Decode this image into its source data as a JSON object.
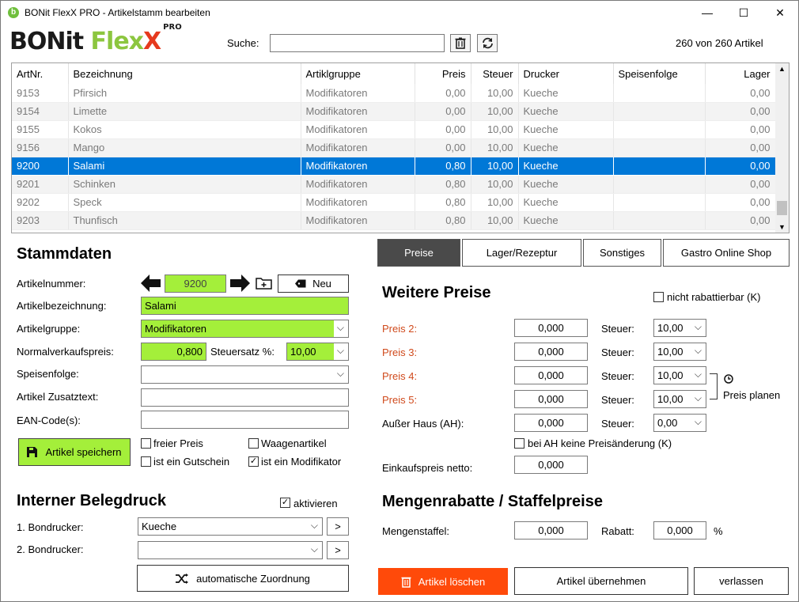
{
  "window": {
    "title": "BONit FlexX PRO - Artikelstamm bearbeiten",
    "minimize": "—",
    "maximize": "☐",
    "close": "✕"
  },
  "logo": {
    "part1": "BONit ",
    "part2": "Fle",
    "part3": "x",
    "part4": "X",
    "pro": "PRO"
  },
  "search": {
    "label": "Suche:",
    "value": ""
  },
  "count": "260 von 260 Artikel",
  "table": {
    "headers": [
      "ArtNr.",
      "Bezeichnung",
      "Artiklgruppe",
      "Preis",
      "Steuer",
      "Drucker",
      "Speisenfolge",
      "Lager"
    ],
    "rows": [
      [
        "9153",
        "Pfirsich",
        "Modifikatoren",
        "0,00",
        "10,00",
        "Kueche",
        "",
        "0,00"
      ],
      [
        "9154",
        "Limette",
        "Modifikatoren",
        "0,00",
        "10,00",
        "Kueche",
        "",
        "0,00"
      ],
      [
        "9155",
        "Kokos",
        "Modifikatoren",
        "0,00",
        "10,00",
        "Kueche",
        "",
        "0,00"
      ],
      [
        "9156",
        "Mango",
        "Modifikatoren",
        "0,00",
        "10,00",
        "Kueche",
        "",
        "0,00"
      ],
      [
        "9200",
        "Salami",
        "Modifikatoren",
        "0,80",
        "10,00",
        "Kueche",
        "",
        "0,00"
      ],
      [
        "9201",
        "Schinken",
        "Modifikatoren",
        "0,80",
        "10,00",
        "Kueche",
        "",
        "0,00"
      ],
      [
        "9202",
        "Speck",
        "Modifikatoren",
        "0,80",
        "10,00",
        "Kueche",
        "",
        "0,00"
      ],
      [
        "9203",
        "Thunfisch",
        "Modifikatoren",
        "0,80",
        "10,00",
        "Kueche",
        "",
        "0,00"
      ]
    ],
    "selected_index": 4
  },
  "stammdaten": {
    "title": "Stammdaten",
    "artikelnummer_label": "Artikelnummer:",
    "artikelnummer": "9200",
    "neu_label": "Neu",
    "bezeichnung_label": "Artikelbezeichnung:",
    "bezeichnung": "Salami",
    "gruppe_label": "Artikelgruppe:",
    "gruppe": "Modifikatoren",
    "vk_label": "Normalverkaufspreis:",
    "vk": "0,800",
    "steuersatz_label": "Steuersatz %:",
    "steuersatz": "10,00",
    "speisenfolge_label": "Speisenfolge:",
    "speisenfolge": "",
    "zusatztext_label": "Artikel Zusatztext:",
    "zusatztext": "",
    "ean_label": "EAN-Code(s):",
    "ean": "",
    "save_label": "Artikel speichern",
    "freier_preis": "freier Preis",
    "waagenartikel": "Waagenartikel",
    "gutschein": "ist ein Gutschein",
    "modifikator": "ist ein Modifikator",
    "check_mark": "✓"
  },
  "belegdruck": {
    "title": "Interner Belegdruck",
    "aktivieren": "aktivieren",
    "drucker1_label": "1. Bondrucker:",
    "drucker1": "Kueche",
    "drucker2_label": "2. Bondrucker:",
    "drucker2": "",
    "arrow": ">",
    "auto_label": "automatische Zuordnung"
  },
  "tabs": [
    "Preise",
    "Lager/Rezeptur",
    "Sonstiges",
    "Gastro Online Shop"
  ],
  "preise": {
    "title": "Weitere Preise",
    "nicht_rabattierbar": "nicht rabattierbar (K)",
    "rows": [
      {
        "label": "Preis 2:",
        "value": "0,000",
        "steuer_label": "Steuer:",
        "steuer": "10,00"
      },
      {
        "label": "Preis 3:",
        "value": "0,000",
        "steuer_label": "Steuer:",
        "steuer": "10,00"
      },
      {
        "label": "Preis 4:",
        "value": "0,000",
        "steuer_label": "Steuer:",
        "steuer": "10,00"
      },
      {
        "label": "Preis 5:",
        "value": "0,000",
        "steuer_label": "Steuer:",
        "steuer": "10,00"
      },
      {
        "label": "Außer Haus (AH):",
        "value": "0,000",
        "steuer_label": "Steuer:",
        "steuer": "0,00"
      }
    ],
    "preis_planen": "Preis planen",
    "ah_keine_aenderung": "bei AH keine Preisänderung (K)",
    "ek_label": "Einkaufspreis netto:",
    "ek": "0,000"
  },
  "mengenrabatte": {
    "title": "Mengenrabatte / Staffelpreise",
    "staffel_label": "Mengenstaffel:",
    "staffel": "0,000",
    "rabatt_label": "Rabatt:",
    "rabatt": "0,000",
    "percent": "%"
  },
  "footer": {
    "loeschen": "Artikel löschen",
    "uebernehmen": "Artikel übernehmen",
    "verlassen": "verlassen"
  },
  "colors": {
    "green": "#a4ef3a",
    "selection": "#0078d7",
    "delete": "#ff4a0a"
  }
}
